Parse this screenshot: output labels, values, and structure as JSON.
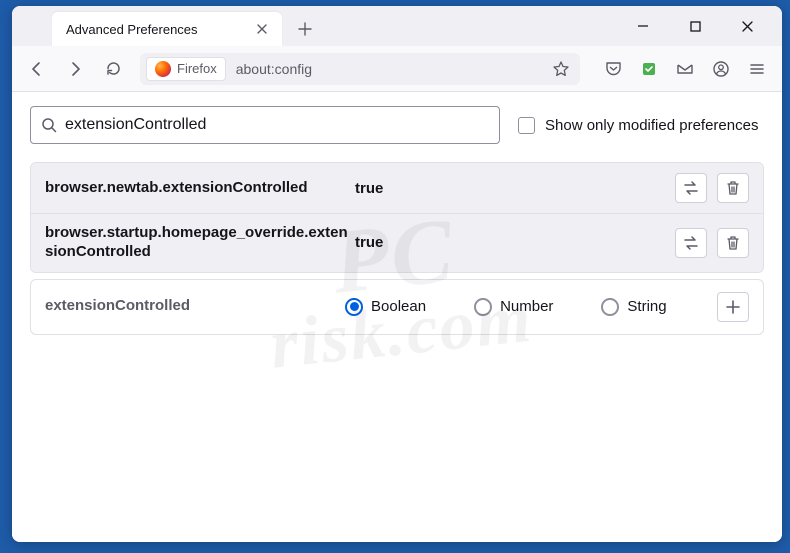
{
  "tab": {
    "title": "Advanced Preferences"
  },
  "urlbar": {
    "identity": "Firefox",
    "url": "about:config"
  },
  "search": {
    "value": "extensionControlled",
    "checkbox_label": "Show only modified preferences"
  },
  "prefs": [
    {
      "name": "browser.newtab.extensionControlled",
      "value": "true"
    },
    {
      "name": "browser.startup.homepage_override.extensionControlled",
      "value": "true"
    }
  ],
  "new_pref": {
    "name": "extensionControlled",
    "types": {
      "boolean": "Boolean",
      "number": "Number",
      "string": "String"
    }
  },
  "watermark": {
    "line1": "PC",
    "line2": "risk.com"
  }
}
